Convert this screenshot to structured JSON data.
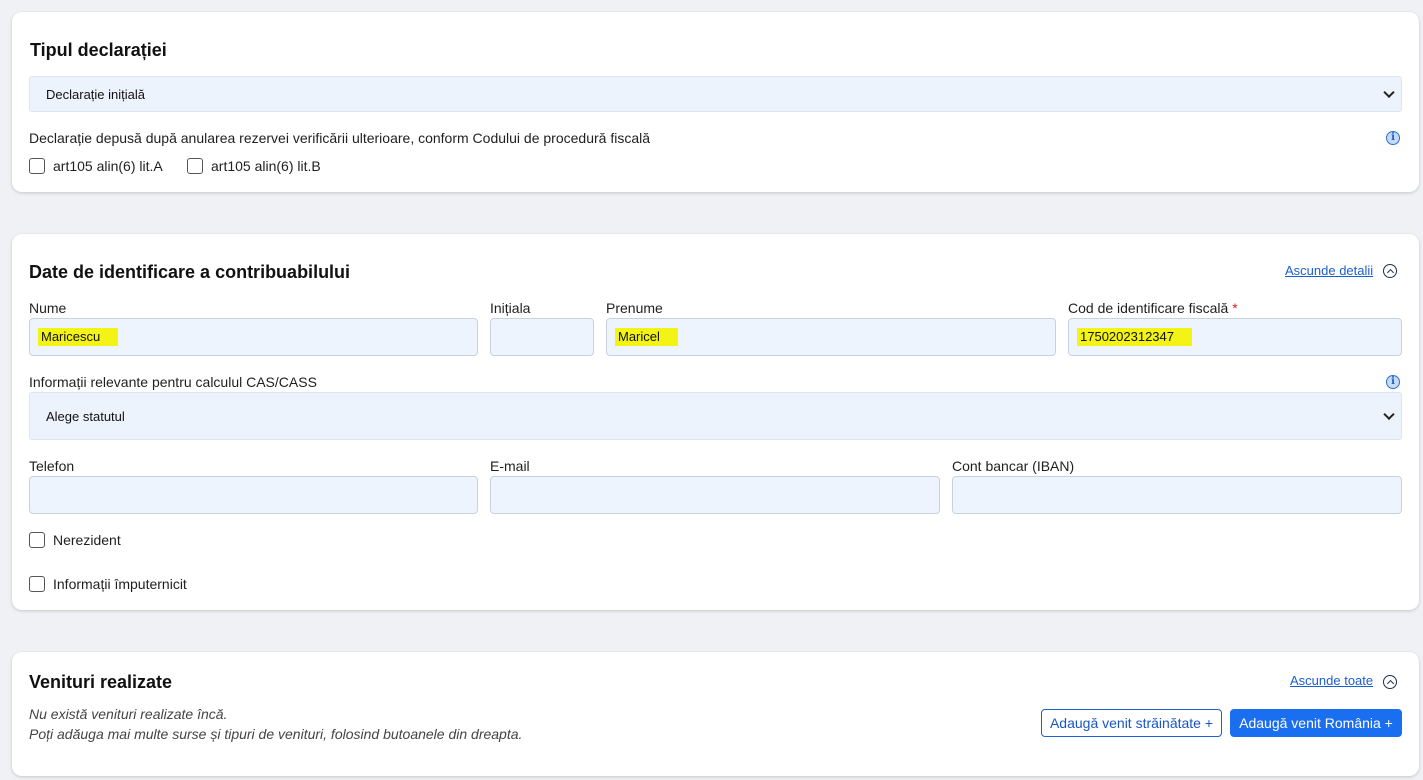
{
  "declaration_type": {
    "title": "Tipul declarației",
    "select_value": "Declarație inițială",
    "note": "Declarație depusă după anularea rezervei verificării ulterioare, conform Codului de procedură fiscală",
    "options": [
      {
        "label": "art105 alin(6) lit.A",
        "checked": false
      },
      {
        "label": "art105 alin(6) lit.B",
        "checked": false
      }
    ]
  },
  "identification": {
    "title": "Date de identificare a contribuabilului",
    "hide_details_label": "Ascunde detalii",
    "fields": {
      "nume": {
        "label": "Nume",
        "value": "Maricescu"
      },
      "initiala": {
        "label": "Inițiala",
        "value": ""
      },
      "prenume": {
        "label": "Prenume",
        "value": "Maricel"
      },
      "cif": {
        "label": "Cod de identificare fiscală",
        "required_mark": "*",
        "value": "1750202312347"
      },
      "cas_cass": {
        "label": "Informații relevante pentru calculul CAS/CASS",
        "value": "Alege statutul"
      },
      "telefon": {
        "label": "Telefon",
        "value": ""
      },
      "email": {
        "label": "E-mail",
        "value": ""
      },
      "iban": {
        "label": "Cont bancar (IBAN)",
        "value": ""
      }
    },
    "nerezident_label": "Nerezident",
    "imputernicit_label": "Informații împuternicit"
  },
  "income": {
    "title": "Venituri realizate",
    "hide_all_label": "Ascunde toate",
    "empty_line1": "Nu există venituri realizate încă.",
    "empty_line2": "Poți adăuga mai multe surse și tipuri de venituri, folosind butoanele din dreapta.",
    "add_foreign_label": "Adaugă venit străinătate +",
    "add_romania_label": "Adaugă venit România +"
  },
  "colors": {
    "accent": "#1a6ef0",
    "highlight": "#f3f315",
    "field_bg": "#eef4fd",
    "page_bg": "#eff1f5"
  }
}
